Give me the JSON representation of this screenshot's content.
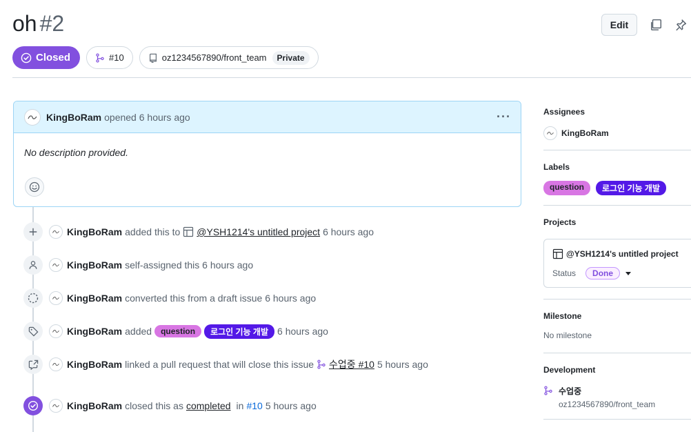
{
  "header": {
    "title": "oh",
    "number": "#2",
    "edit_label": "Edit"
  },
  "status": {
    "state_label": "Closed",
    "linked_pr": "#10",
    "repo": "oz1234567890/front_team",
    "visibility": "Private"
  },
  "comment": {
    "author": "KingBoRam",
    "meta": "opened 6 hours ago",
    "body": "No description provided."
  },
  "timeline": [
    {
      "user": "KingBoRam",
      "text": "added this to",
      "link": "@YSH1214's untitled project",
      "time": "6 hours ago"
    },
    {
      "user": "KingBoRam",
      "text": "self-assigned this 6 hours ago"
    },
    {
      "user": "KingBoRam",
      "text": "converted this from a draft issue 6 hours ago"
    },
    {
      "user": "KingBoRam",
      "text": "added",
      "labels": [
        "question",
        "로그인 기능 개발"
      ],
      "time": "6 hours ago"
    },
    {
      "user": "KingBoRam",
      "text": "linked a pull request that will close this issue",
      "link": "수업중 #10",
      "time": "5 hours ago"
    },
    {
      "user": "KingBoRam",
      "text": "closed this as",
      "link": "completed",
      "in": "in",
      "ref": "#10",
      "time": "5 hours ago"
    }
  ],
  "sidebar": {
    "assignees_heading": "Assignees",
    "assignee": "KingBoRam",
    "labels_heading": "Labels",
    "labels": [
      "question",
      "로그인 기능 개발"
    ],
    "projects_heading": "Projects",
    "project_name": "@YSH1214's untitled project",
    "status_label": "Status",
    "status_value": "Done",
    "milestone_heading": "Milestone",
    "milestone_value": "No milestone",
    "development_heading": "Development",
    "dev_branch": "수업중",
    "dev_repo": "oz1234567890/front_team"
  },
  "colors": {
    "closed_purple": "#8250df",
    "label_question": "#d876e3",
    "label_login": "#5319e7",
    "link_blue": "#0969da",
    "comment_header_bg": "#ddf4ff"
  }
}
